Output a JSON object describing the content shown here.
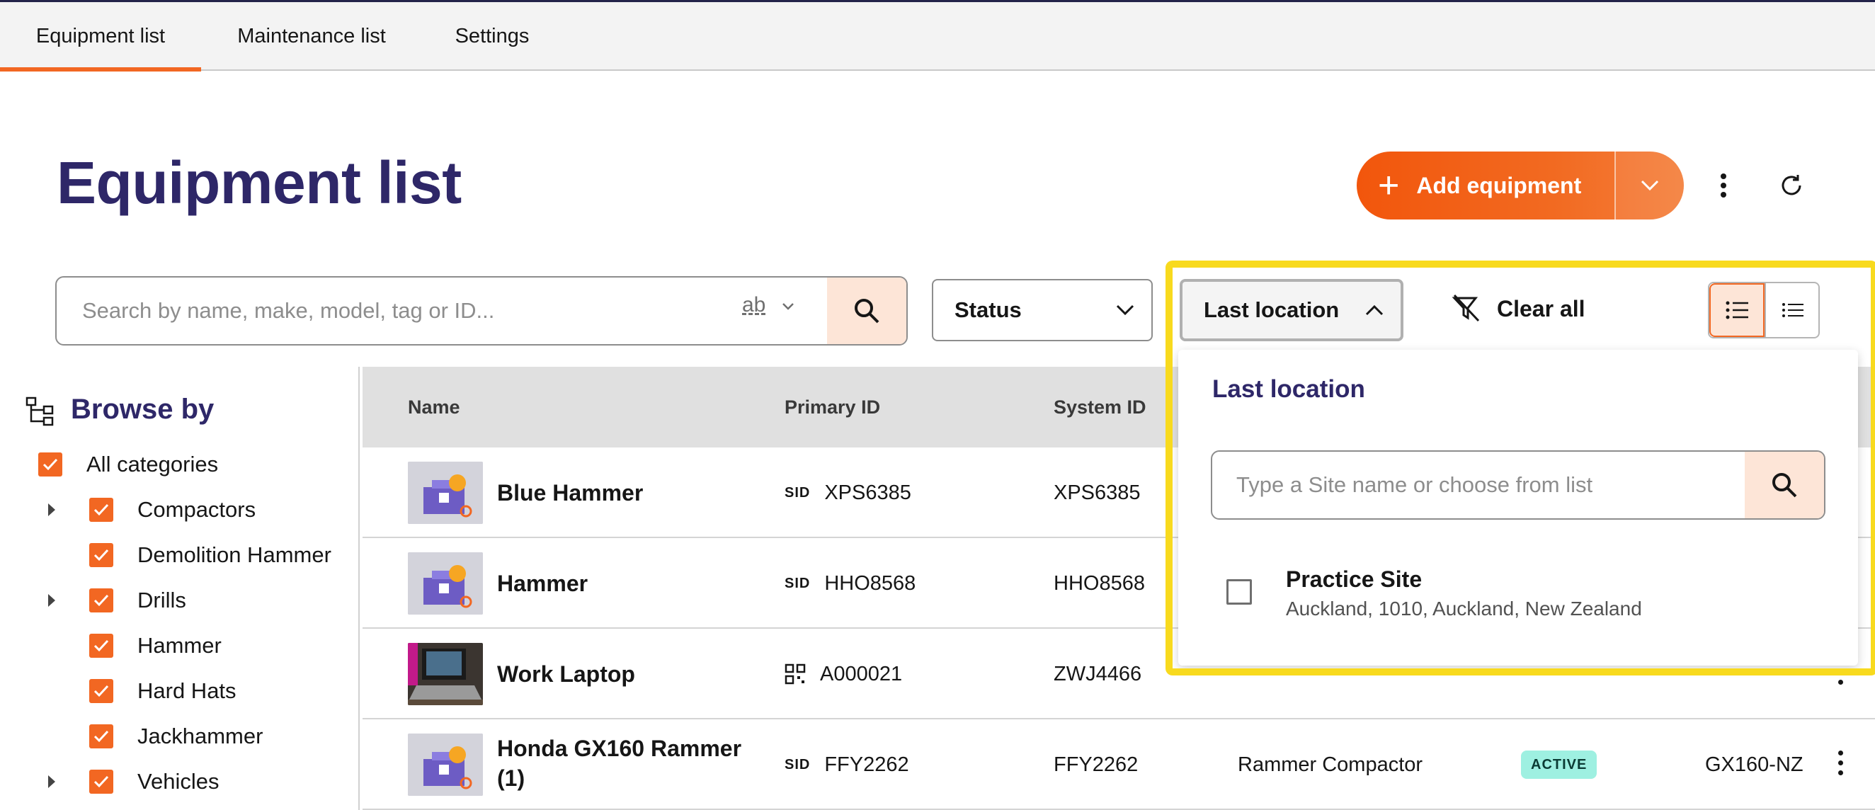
{
  "nav": {
    "tabs": [
      {
        "label": "Equipment list",
        "active": true
      },
      {
        "label": "Maintenance list",
        "active": false
      },
      {
        "label": "Settings",
        "active": false
      }
    ]
  },
  "header": {
    "title": "Equipment list",
    "add_button": "Add equipment"
  },
  "search": {
    "placeholder": "Search by name, make, model, tag or ID...",
    "mode_label": "ab"
  },
  "filters": {
    "status_label": "Status",
    "location_label": "Last location",
    "clear_all": "Clear all"
  },
  "sidebar": {
    "title": "Browse by",
    "items": [
      {
        "label": "All categories",
        "checked": true,
        "expandable": false,
        "level": 0
      },
      {
        "label": "Compactors",
        "checked": true,
        "expandable": true,
        "level": 1
      },
      {
        "label": "Demolition Hammer",
        "checked": true,
        "expandable": false,
        "level": 1
      },
      {
        "label": "Drills",
        "checked": true,
        "expandable": true,
        "level": 1
      },
      {
        "label": "Hammer",
        "checked": true,
        "expandable": false,
        "level": 1
      },
      {
        "label": "Hard Hats",
        "checked": true,
        "expandable": false,
        "level": 1
      },
      {
        "label": "Jackhammer",
        "checked": true,
        "expandable": false,
        "level": 1
      },
      {
        "label": "Vehicles",
        "checked": true,
        "expandable": true,
        "level": 1
      }
    ]
  },
  "table": {
    "columns": [
      "Name",
      "Primary ID",
      "System ID"
    ],
    "rows": [
      {
        "name_line1": "Blue Hammer",
        "name_line2": "",
        "id_type": "SID",
        "primary_id": "XPS6385",
        "system_id": "XPS6385",
        "category": "",
        "status": "",
        "model": ""
      },
      {
        "name_line1": "Hammer",
        "name_line2": "",
        "id_type": "SID",
        "primary_id": "HHO8568",
        "system_id": "HHO8568",
        "category": "",
        "status": "",
        "model": ""
      },
      {
        "name_line1": "Work Laptop",
        "name_line2": "",
        "id_type": "QR",
        "primary_id": "A000021",
        "system_id": "ZWJ4466",
        "category": "",
        "status": "",
        "model": ""
      },
      {
        "name_line1": "Honda GX160 Rammer",
        "name_line2": "(1)",
        "id_type": "SID",
        "primary_id": "FFY2262",
        "system_id": "FFY2262",
        "category": "Rammer Compactor",
        "status": "ACTIVE",
        "model": "GX160-NZ"
      }
    ]
  },
  "location_popover": {
    "title": "Last location",
    "search_placeholder": "Type a Site name or choose from list",
    "sites": [
      {
        "name": "Practice Site",
        "address": "Auckland, 1010, Auckland, New Zealand",
        "checked": false
      }
    ]
  },
  "colors": {
    "brand": "#f26722",
    "title": "#2e2768",
    "badge_active": "#9ef0e1",
    "highlight": "#f8da1e"
  }
}
